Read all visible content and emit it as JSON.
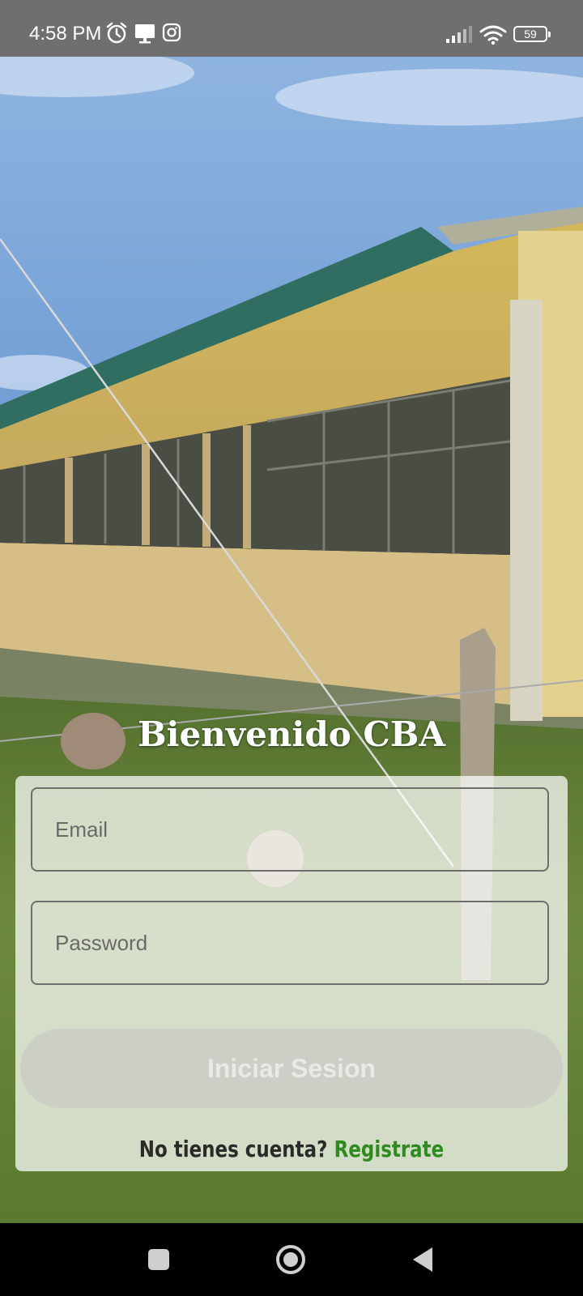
{
  "status_bar": {
    "time": "4:58 PM",
    "battery_level": "59",
    "icons": [
      "alarm-icon",
      "screen-cast-icon",
      "instagram-icon",
      "signal-icon",
      "wifi-icon",
      "battery-icon"
    ]
  },
  "login": {
    "title": "Bienvenido CBA",
    "email_placeholder": "Email",
    "password_placeholder": "Password",
    "submit_label": "Iniciar Sesion",
    "no_account_text": "No tienes cuenta?",
    "register_link": "Registrate"
  },
  "colors": {
    "register_link": "#2e8b1f",
    "status_bar": "#6f6f6f",
    "nav_bar": "#000000"
  },
  "nav_bar": {
    "buttons": [
      "recents-icon",
      "home-icon",
      "back-icon"
    ]
  }
}
